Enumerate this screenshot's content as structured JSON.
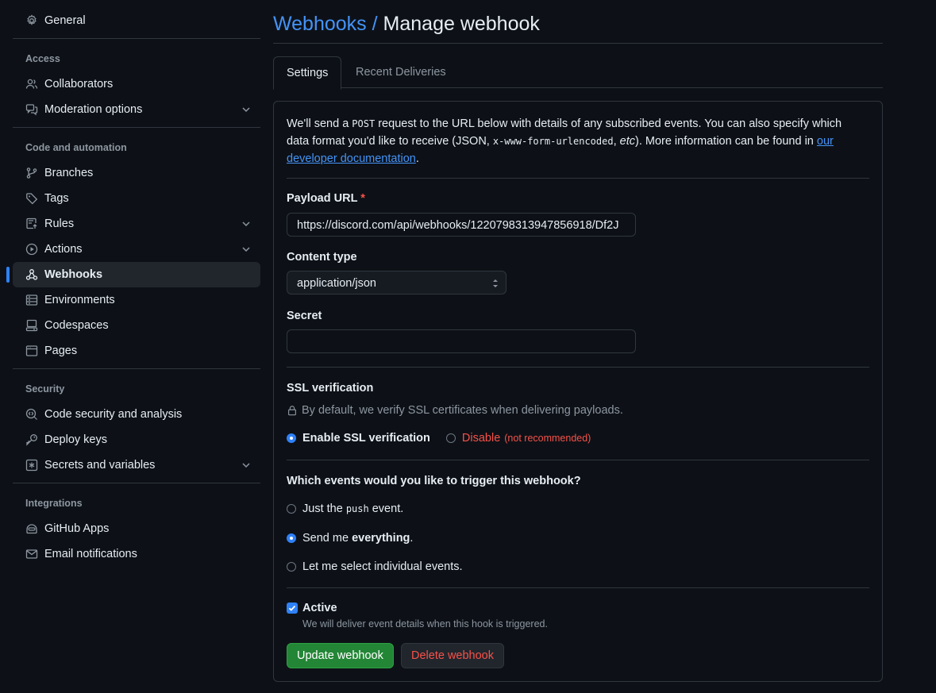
{
  "sidebar": {
    "general": "General",
    "access_heading": "Access",
    "collaborators": "Collaborators",
    "moderation": "Moderation options",
    "code_heading": "Code and automation",
    "branches": "Branches",
    "tags": "Tags",
    "rules": "Rules",
    "actions": "Actions",
    "webhooks": "Webhooks",
    "environments": "Environments",
    "codespaces": "Codespaces",
    "pages": "Pages",
    "security_heading": "Security",
    "code_security": "Code security and analysis",
    "deploy_keys": "Deploy keys",
    "secrets": "Secrets and variables",
    "integrations_heading": "Integrations",
    "github_apps": "GitHub Apps",
    "email_notifications": "Email notifications"
  },
  "header": {
    "crumb": "Webhooks",
    "separator": "/",
    "title": "Manage webhook"
  },
  "tabs": {
    "settings": "Settings",
    "recent": "Recent Deliveries"
  },
  "intro": {
    "part1": "We'll send a ",
    "post": "POST",
    "part2": " request to the URL below with details of any subscribed events. You can also specify which data format you'd like to receive (JSON, ",
    "form": "x-www-form-urlencoded",
    "part3": ", ",
    "etc": "etc",
    "part4": "). More information can be found in ",
    "link": "our developer documentation",
    "part5": "."
  },
  "form": {
    "payload_label": "Payload URL",
    "required_mark": "*",
    "payload_value": "https://discord.com/api/webhooks/1220798313947856918/Df2J",
    "content_type_label": "Content type",
    "content_type_value": "application/json",
    "secret_label": "Secret",
    "secret_value": ""
  },
  "ssl": {
    "heading": "SSL verification",
    "note": "By default, we verify SSL certificates when delivering payloads.",
    "enable": "Enable SSL verification",
    "disable": "Disable",
    "not_recommended": "(not recommended)"
  },
  "events": {
    "heading": "Which events would you like to trigger this webhook?",
    "just_pre": "Just the ",
    "just_code": "push",
    "just_post": " event.",
    "send_pre": "Send me ",
    "send_bold": "everything",
    "send_post": ".",
    "select": "Let me select individual events."
  },
  "active": {
    "label": "Active",
    "note": "We will deliver event details when this hook is triggered."
  },
  "buttons": {
    "update": "Update webhook",
    "delete": "Delete webhook"
  }
}
